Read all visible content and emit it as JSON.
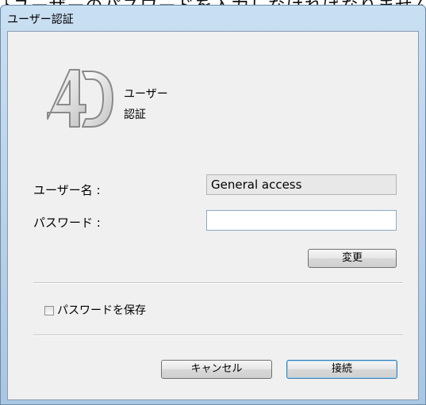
{
  "background_partial_text": "ﾄユーザーのパスワードを入力しなければなりません",
  "window": {
    "title": "ユーザー認証"
  },
  "logo": {
    "caption": "ユーザー\n認証"
  },
  "form": {
    "username_label": "ユーザー名 :",
    "username_value": "General access",
    "password_label": "パスワード :",
    "password_value": "",
    "change_button": "変更",
    "save_password_label": "パスワードを保存",
    "save_password_checked": false
  },
  "buttons": {
    "cancel": "キャンセル",
    "connect": "接続"
  },
  "colors": {
    "title_gradient_top": "#c9dff2",
    "client_bg": "#f0f0f0",
    "default_button_border": "#3c7fb1"
  }
}
